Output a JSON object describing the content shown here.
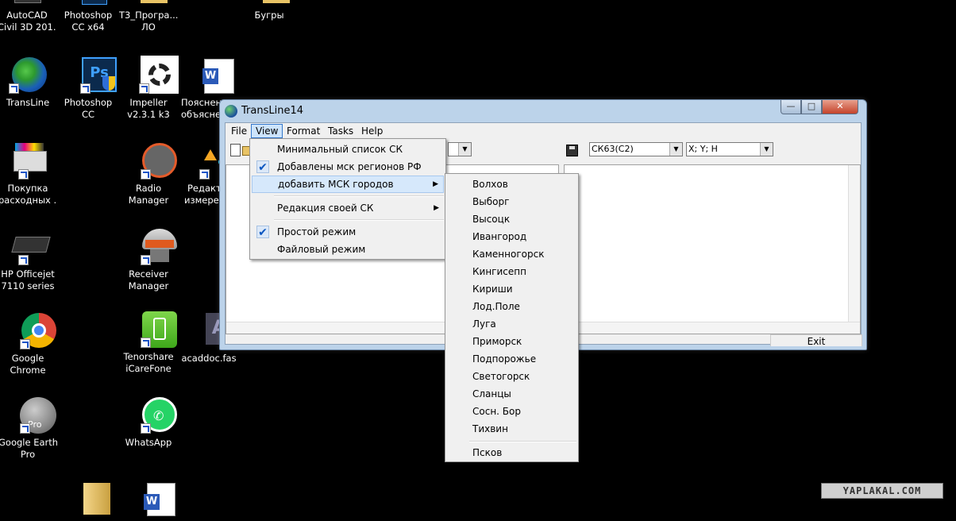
{
  "desktop_icons": {
    "autocad": {
      "label": "AutoCAD\nCivil 3D 201...",
      "line1": "AutoCAD",
      "line2": "Civil 3D 201...",
      "icon": "autocad-icon"
    },
    "photoshop_x64": {
      "line1": "Photoshop",
      "line2": "CC x64",
      "icon": "photoshop-icon"
    },
    "t3": {
      "line1": "Т3_Програ...",
      "line2": "ЛО",
      "icon": "folder-icon"
    },
    "bugry": {
      "line1": "Бугры",
      "icon": "folder-icon"
    },
    "transline": {
      "line1": "TransLine",
      "icon": "globe-icon"
    },
    "photoshop_cc": {
      "line1": "Photoshop",
      "line2": "CC",
      "icon": "photoshop-icon"
    },
    "impeller": {
      "line1": "Impeller",
      "line2": "v2.3.1 k3",
      "icon": "fan-icon"
    },
    "poyasnen": {
      "line1": "Пояснен",
      "line2": "объясне",
      "icon": "word-document-icon"
    },
    "pokupka": {
      "line1": "Покупка",
      "line2": "расходных ...",
      "icon": "printer-icon"
    },
    "radio": {
      "line1": "Radio",
      "line2": "Manager",
      "icon": "radio-icon"
    },
    "redakt": {
      "line1": "Редакт",
      "line2": "измерен",
      "icon": "editor-icon"
    },
    "hp": {
      "line1": "HP Officejet",
      "line2": "7110 series",
      "icon": "printer-icon"
    },
    "receiver": {
      "line1": "Receiver",
      "line2": "Manager",
      "icon": "gnss-receiver-icon"
    },
    "chrome": {
      "line1": "Google",
      "line2": "Chrome",
      "icon": "chrome-icon"
    },
    "tenorshare": {
      "line1": "Tenorshare",
      "line2": "iCareFone",
      "icon": "phone-icon"
    },
    "acaddoc": {
      "line1": "acaddoc.fas",
      "icon": "fas-file-icon"
    },
    "earth": {
      "line1": "Google Earth",
      "line2": "Pro",
      "badge": "Pro",
      "icon": "google-earth-icon"
    },
    "whatsapp": {
      "line1": "WhatsApp",
      "icon": "whatsapp-icon"
    }
  },
  "window": {
    "title": "TransLine14",
    "controls": {
      "minimize": "—",
      "maximize": "□",
      "close": "✕"
    },
    "menus": [
      "File",
      "View",
      "Format",
      "Tasks",
      "Help"
    ],
    "toolbar": {
      "combo_cs": "СК63(С2)",
      "combo_format": "X; Y; H"
    },
    "exit_label": "Exit"
  },
  "view_menu": {
    "items": [
      {
        "label": "Минимальный список СК",
        "checked": false
      },
      {
        "label": "Добавлены мск регионов РФ",
        "checked": true
      },
      {
        "label": "добавить МСК городов",
        "submenu": true
      },
      {
        "label": "Редакция своей СК",
        "submenu": true
      },
      {
        "label": "Простой режим",
        "checked": true
      },
      {
        "label": "Файловый режим",
        "checked": false
      }
    ],
    "check_glyph": "✔",
    "arrow_glyph": "▶"
  },
  "city_menu": {
    "items": [
      "Волхов",
      "Выборг",
      "Высоцк",
      "Ивангород",
      "Каменногорск",
      "Кингисепп",
      "Кириши",
      "Лод.Поле",
      "Луга",
      "Приморск",
      "Подпорожье",
      "Светогорск",
      "Сланцы",
      "Сосн. Бор",
      "Тихвин"
    ],
    "after_separator": "Псков"
  },
  "watermark": "YAPLAKAL.COM"
}
